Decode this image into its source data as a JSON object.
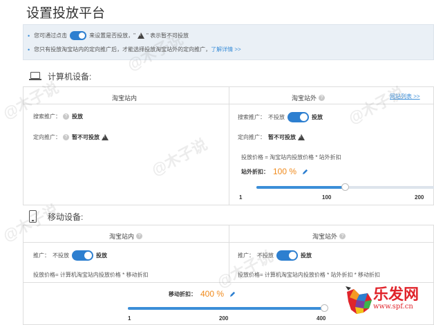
{
  "page": {
    "title": "设置投放平台"
  },
  "notice": {
    "line1_prefix": "您可通过点击",
    "line1_middle": "来设置是否投放，\"",
    "line1_suffix": "\" 表示暂不可投放",
    "line2_text": "您只有投放淘宝站内的定向推广后，才能选择投放淘宝站外的定向推广，",
    "line2_link": "了解详情 >>"
  },
  "pc": {
    "title": "计算机设备:",
    "inside": {
      "header": "淘宝站内",
      "search_label": "搜索推广：",
      "search_value": "投放",
      "target_label": "定向推广：",
      "target_value": "暂不可投放"
    },
    "outside": {
      "header": "淘宝站外",
      "site_list_link": "网站列表 >>",
      "search_label": "搜索推广：",
      "search_off": "不投放",
      "search_on": "投放",
      "target_label": "定向推广：",
      "target_value": "暂不可投放",
      "formula": "投放价格 = 淘宝站内投放价格 * 站外折扣",
      "discount_label": "站外折扣：",
      "discount_value": "100 %",
      "slider": {
        "min_label": "1",
        "mid_label": "100",
        "max_label": "200",
        "value": 100,
        "min": 1,
        "max": 200
      }
    }
  },
  "mobile": {
    "title": "移动设备:",
    "inside": {
      "header": "淘宝站内",
      "promo_label": "推广：",
      "off": "不投放",
      "on": "投放",
      "formula": "投放价格= 计算机淘宝站内投放价格 * 移动折扣"
    },
    "outside": {
      "header": "淘宝站外",
      "promo_label": "推广：",
      "off": "不投放",
      "on": "投放",
      "formula": "投放价格= 计算机淘宝站内投放价格 * 站外折扣 * 移动折扣"
    },
    "discount_label": "移动折扣：",
    "discount_value": "400 %",
    "slider": {
      "min_label": "1",
      "mid_label": "200",
      "max_label": "400",
      "value": 400,
      "min": 1,
      "max": 400
    }
  },
  "watermarks": [
    "@木子说",
    "@木子说",
    "@木子说",
    "@木子说",
    "@木子说",
    "@木子说"
  ],
  "brand": {
    "logo": "乐发网",
    "site": "www.spf.cn"
  },
  "colors": {
    "accent": "#2d7fd0",
    "orange": "#f08a1c",
    "notice_bg": "#eaf0f6",
    "brand_red": "#e0242b"
  }
}
